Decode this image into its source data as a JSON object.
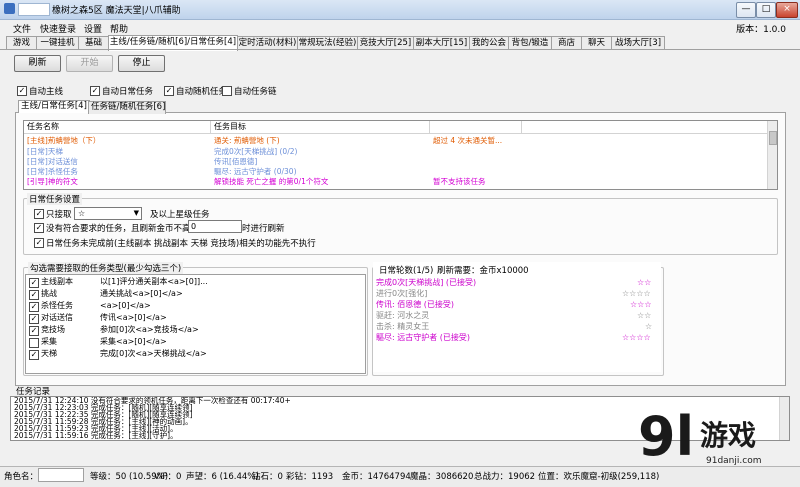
{
  "window": {
    "title": "橡树之森5区 魔法天堂|八爪辅助",
    "min": "—",
    "max": "□",
    "close": "×"
  },
  "menu": [
    "文件",
    "快速登录",
    "设置",
    "帮助"
  ],
  "version": "版本：1.0.0",
  "tabs": [
    "游戏",
    "一键挂机",
    "基础",
    "主线/任务链/随机[6]/日常任务[4]",
    "定时活动(材料)",
    "常规玩法(经验)",
    "竞技大厅[25]",
    "副本大厅[15]",
    "我的公会",
    "背包/锻造",
    "商店",
    "聊天",
    "战场大厅[3]"
  ],
  "buttons": {
    "refresh": "刷新",
    "start": "开始",
    "stop": "停止"
  },
  "auto_options": [
    {
      "label": "自动主线",
      "checked": true
    },
    {
      "label": "自动日常任务",
      "checked": true
    },
    {
      "label": "自动随机任务",
      "checked": true
    },
    {
      "label": "自动任务链",
      "checked": false
    }
  ],
  "subtabs": [
    "主线/日常任务[4]",
    "任务链/随机任务[6]"
  ],
  "quest_table": {
    "headers": [
      "任务名称",
      "任务目标"
    ],
    "rows": [
      {
        "name": "[主线]荊蚺營地（下）",
        "goal": "通关: 荊蚺營地 (下)",
        "note": "超过 4 次未通关暂...",
        "color": "#e05a00"
      },
      {
        "name": "[日常]天梯",
        "goal": "完成0次[天梯挑战] (0/2)",
        "note": "",
        "color": "#6c8fd8"
      },
      {
        "name": "[日常]对话送信",
        "goal": "传讯[佰恩德]",
        "note": "",
        "color": "#6c8fd8"
      },
      {
        "name": "[日常]杀怪任务",
        "goal": "驅尽: 远古守护者 (0/30)",
        "note": "",
        "color": "#6c8fd8"
      },
      {
        "name": "[引导]神的符文",
        "goal": "解锁技能 死亡之握 的第0/1个符文",
        "note": "暂不支持该任务",
        "color": "#d400d4"
      }
    ]
  },
  "daily_settings": {
    "group_label": "日常任务设置",
    "only_accept": {
      "label": "只接取",
      "checked": true
    },
    "star_select": "☆",
    "star_suffix": "及以上星级任务",
    "refresh_rule": {
      "label": "没有符合要求的任务，且刷新金币不高于",
      "checked": true,
      "value": "0",
      "suffix": "时进行刷新"
    },
    "skip_rule": {
      "label": "日常任务未完成前(主线副本 挑战副本 天梯 竞技场)相关的功能先不执行",
      "checked": true
    }
  },
  "types_group": {
    "label": "勾选需要接取的任务类型(最少勾选三个)",
    "items": [
      {
        "name": "主线副本",
        "desc": "以[1]评分通关副本<a>[0]]...",
        "checked": true
      },
      {
        "name": "挑战",
        "desc": "通关挑战<a>[0]</a>",
        "checked": true
      },
      {
        "name": "杀怪任务",
        "desc": "<a>[0]</a>",
        "checked": true
      },
      {
        "name": "对话送信",
        "desc": "传讯<a>[0]</a>",
        "checked": true
      },
      {
        "name": "竞技场",
        "desc": "参加[0]次<a>竞技场</a>",
        "checked": true
      },
      {
        "name": "采集",
        "desc": "采集<a>[0]</a>",
        "checked": false
      },
      {
        "name": "天梯",
        "desc": "完成[0]次<a>天梯挑战</a>",
        "checked": true
      }
    ]
  },
  "daily_round": {
    "label": "日常轮数(1/5)",
    "refresh_need": "刷新需要：金币x10000",
    "items": [
      {
        "text": "完成0次[天梯挑战] (已接受)",
        "stars": "☆☆",
        "color": "#cc00cc"
      },
      {
        "text": "进行0次[强化]",
        "stars": "☆☆☆☆",
        "color": "#888888"
      },
      {
        "text": "传讯: 佰恩德 (已接受)",
        "stars": "☆☆☆",
        "color": "#cc00cc"
      },
      {
        "text": "驱赶: 河水之灵",
        "stars": "☆☆",
        "color": "#888888"
      },
      {
        "text": "击杀: 精灵女王",
        "stars": "☆",
        "color": "#888888"
      },
      {
        "text": "驅尽: 远古守护者 (已接受)",
        "stars": "☆☆☆☆",
        "color": "#cc00cc"
      }
    ]
  },
  "log": {
    "label": "任务记录",
    "lines": [
      "2015/7/31 12:24:10 没有符合要求的领机任务，距离下一次检查还有 00:17:40+",
      "2015/7/31 12:23:03 完成任务：[随机][随享连续领]",
      "2015/7/31 12:22:35 完成任务：[随机][随享连续领]",
      "2015/7/31 11:59:28 完成任务：[主线][神的动画]。",
      "2015/7/31 11:59:23 完成任务：[主线][活动]。",
      "2015/7/31 11:59:16 完成任务：[主线][守护]。"
    ]
  },
  "status": {
    "char_label": "角色名：",
    "level": "等级：50 (10.59%)",
    "vip": "VIP：0",
    "fame": "声望：6 (16.44%)",
    "diamond": "钻石：0",
    "lottery": "彩钻：1193",
    "gold": "金币：14764794",
    "crystal": "魔晶：3086620",
    "power": "总战力：19062",
    "position": "位置：欢乐魔窟-初级(259,118)"
  },
  "watermark": {
    "num": "9l",
    "cn": "游戏",
    "url": "91danji.com"
  },
  "colors": {
    "accent": "#cc00cc",
    "main_quest": "#e05a00",
    "daily_quest": "#6c8fd8"
  }
}
